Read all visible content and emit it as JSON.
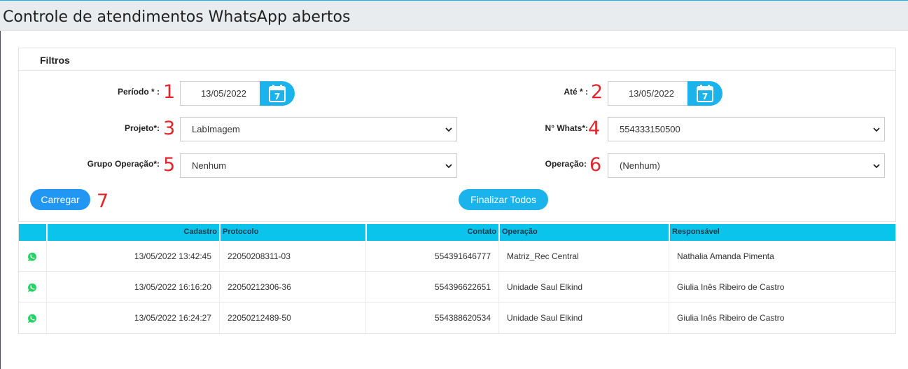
{
  "page": {
    "title": "Controle de atendimentos WhatsApp abertos"
  },
  "filters": {
    "title": "Filtros",
    "periodo": {
      "label": "Período * :",
      "value": "13/05/2022",
      "marker": "1"
    },
    "ate": {
      "label": "Até * :",
      "value": "13/05/2022",
      "marker": "2"
    },
    "projeto": {
      "label": "Projeto*:",
      "value": "LabImagem",
      "marker": "3"
    },
    "whats": {
      "label": "N° Whats*:",
      "value": "554333150500",
      "marker": "4"
    },
    "grupo": {
      "label": "Grupo Operação*:",
      "value": "Nenhum",
      "marker": "5"
    },
    "operacao": {
      "label": "Operação:",
      "value": "(Nenhum)",
      "marker": "6"
    },
    "carregar": {
      "label": "Carregar",
      "marker": "7"
    },
    "finalizar": {
      "label": "Finalizar Todos"
    }
  },
  "table": {
    "headers": [
      "",
      "Cadastro",
      "Protocolo",
      "Contato",
      "Operação",
      "Responsável"
    ],
    "rows": [
      {
        "icon": "whatsapp-icon",
        "cadastro": "13/05/2022 13:42:45",
        "protocolo": "22050208311-03",
        "contato": "554391646777",
        "operacao": "Matriz_Rec Central",
        "responsavel": "Nathalia Amanda Pimenta"
      },
      {
        "icon": "whatsapp-icon",
        "cadastro": "13/05/2022 16:16:20",
        "protocolo": "22050212306-36",
        "contato": "554396622651",
        "operacao": "Unidade Saul Elkind",
        "responsavel": "Giulia Inês Ribeiro de Castro"
      },
      {
        "icon": "whatsapp-icon",
        "cadastro": "13/05/2022 16:24:27",
        "protocolo": "22050212489-50",
        "contato": "554388620534",
        "operacao": "Unidade Saul Elkind",
        "responsavel": "Giulia Inês Ribeiro de Castro"
      }
    ]
  },
  "colors": {
    "accent": "#1ab3eb",
    "button": "#2196f3",
    "header": "#0ac4ec",
    "marker": "#e3252b",
    "whatsapp": "#25d366"
  }
}
